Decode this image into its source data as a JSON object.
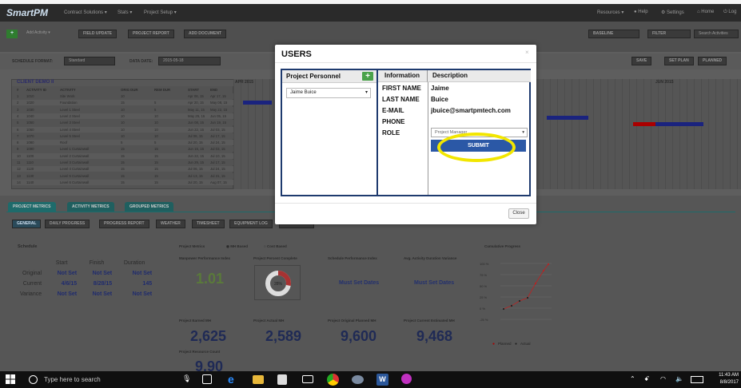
{
  "app": {
    "logo": "SmartPM",
    "nav": [
      "Contract Solutions ▾",
      "Stats ▾",
      "Project Setup ▾"
    ],
    "nav_right": [
      "Resources ▾",
      "Help",
      "Settings",
      "Home",
      "Log"
    ]
  },
  "toolbar": {
    "add_activity": "Add Activity",
    "buttons": [
      "FIELD UPDATE",
      "PROJECT REPORT",
      "ADD DOCUMENT"
    ],
    "baseline": "BASELINE",
    "filter": "FILTER",
    "search_placeholder": "Search Activities"
  },
  "schedule_bar": {
    "format_label": "SCHEDULE FORMAT:",
    "format_value": "Standard",
    "date_label": "DATA DATE:",
    "date_value": "2015-05-18",
    "btn_save": "SAVE",
    "btn_set_plan": "SET PLAN",
    "btn_planned": "PLANNED"
  },
  "grid": {
    "title": "CLIENT DEMO II",
    "headers": [
      "#",
      "ACTIVITY ID",
      "ACTIVITY",
      "ORIG DUR",
      "REM DUR",
      "START",
      "END"
    ],
    "rows": [
      [
        "1",
        "1010",
        "Site Work",
        "10",
        "",
        "Apr 06, 15",
        "Apr 17, 15"
      ],
      [
        "2",
        "1020",
        "Foundation",
        "15",
        "5",
        "Apr 20, 15",
        "May 08, 15"
      ],
      [
        "3",
        "1030",
        "Level 1 Steel",
        "10",
        "5",
        "May 11, 15",
        "May 22, 15"
      ],
      [
        "4",
        "1040",
        "Level 2 Steel",
        "10",
        "10",
        "May 25, 15",
        "Jun 05, 15"
      ],
      [
        "5",
        "1050",
        "Level 3 Steel",
        "10",
        "10",
        "Jun 08, 15",
        "Jun 19, 15"
      ],
      [
        "6",
        "1060",
        "Level 4 Steel",
        "10",
        "10",
        "Jun 22, 15",
        "Jul 03, 15"
      ],
      [
        "7",
        "1070",
        "Level 5 Steel",
        "10",
        "10",
        "Jul 06, 15",
        "Jul 17, 15"
      ],
      [
        "8",
        "1080",
        "Roof",
        "5",
        "5",
        "Jul 20, 15",
        "Jul 24, 15"
      ],
      [
        "9",
        "1090",
        "Level 1 Curtainwall",
        "15",
        "15",
        "Jun 15, 15",
        "Jul 03, 15"
      ],
      [
        "10",
        "1100",
        "Level 2 Curtainwall",
        "15",
        "15",
        "Jun 22, 15",
        "Jul 10, 15"
      ],
      [
        "11",
        "1110",
        "Level 3 Curtainwall",
        "15",
        "15",
        "Jun 29, 15",
        "Jul 17, 15"
      ],
      [
        "12",
        "1120",
        "Level 4 Curtainwall",
        "15",
        "15",
        "Jul 06, 15",
        "Jul 24, 15"
      ],
      [
        "13",
        "1130",
        "Level 5 Curtainwall",
        "15",
        "15",
        "Jul 13, 15",
        "Jul 31, 15"
      ],
      [
        "14",
        "1140",
        "Level 6 Curtainwall",
        "15",
        "15",
        "Jul 20, 15",
        "Aug 07, 15"
      ]
    ],
    "months": [
      "APR 2015",
      "JUN 2015"
    ]
  },
  "tabs": [
    "PROJECT METRICS",
    "ACTIVITY METRICS",
    "GROUPED METRICS"
  ],
  "subtabs": [
    "GENERAL",
    "DAILY PROGRESS",
    "PROGRESS REPORT",
    "WEATHER",
    "TIMESHEET",
    "EQUIPMENT LOG",
    "DOCUMENTS"
  ],
  "metrics": {
    "schedule_title": "Schedule",
    "cols": [
      "Start",
      "Finish",
      "Duration"
    ],
    "rows": [
      {
        "label": "Original",
        "start": "Not Set",
        "finish": "Not Set",
        "duration": "Not Set"
      },
      {
        "label": "Current",
        "start": "4/6/15",
        "finish": "8/28/15",
        "duration": "145"
      },
      {
        "label": "Variance",
        "start": "Not Set",
        "finish": "Not Set",
        "duration": "Not Set"
      }
    ],
    "project_metrics_label": "Project Metrics",
    "radio_mh": "MH Based",
    "radio_cost": "Cost Based",
    "mpi_title": "Manpower Performance Index",
    "mpi_value": "1.01",
    "pct_title": "Project Percent Complete",
    "pct_value": "28%",
    "pct_fraction": 0.28,
    "spi_title": "Schedule Performance Index",
    "spi_value": "Must Set Dates",
    "adv_title": "Avg. Activity Duration Variance",
    "adv_value": "Must Set Dates",
    "cum_title": "Cumulative Progress",
    "earned_title": "Project Earned MH",
    "earned_value": "2,625",
    "actual_title": "Project Actual MH",
    "actual_value": "2,589",
    "orig_title": "Project Original Planned MH",
    "orig_value": "9,600",
    "est_title": "Project Current Estimated MH",
    "est_value": "9,468",
    "resource_title": "Project Resource Count",
    "resource_value": "9.90",
    "legend_planned": "Planned",
    "legend_actual": "Actual"
  },
  "modal": {
    "title": "USERS",
    "personnel_header": "Project Personnel",
    "add_symbol": "+",
    "selected_person": "Jaime Buice",
    "info_header": "Information",
    "desc_header": "Description",
    "fields": [
      {
        "label": "FIRST NAME",
        "value": "Jaime"
      },
      {
        "label": "LAST NAME",
        "value": "Buice"
      },
      {
        "label": "E-MAIL",
        "value": "jbuice@smartpmtech.com"
      },
      {
        "label": "PHONE",
        "value": ""
      },
      {
        "label": "ROLE",
        "value": ""
      }
    ],
    "role_value": "Project Manager",
    "submit": "SUBMIT",
    "close": "Close",
    "x": "×"
  },
  "taskbar": {
    "search": "Type here to search",
    "time": "11:43 AM",
    "date": "8/8/2017"
  }
}
